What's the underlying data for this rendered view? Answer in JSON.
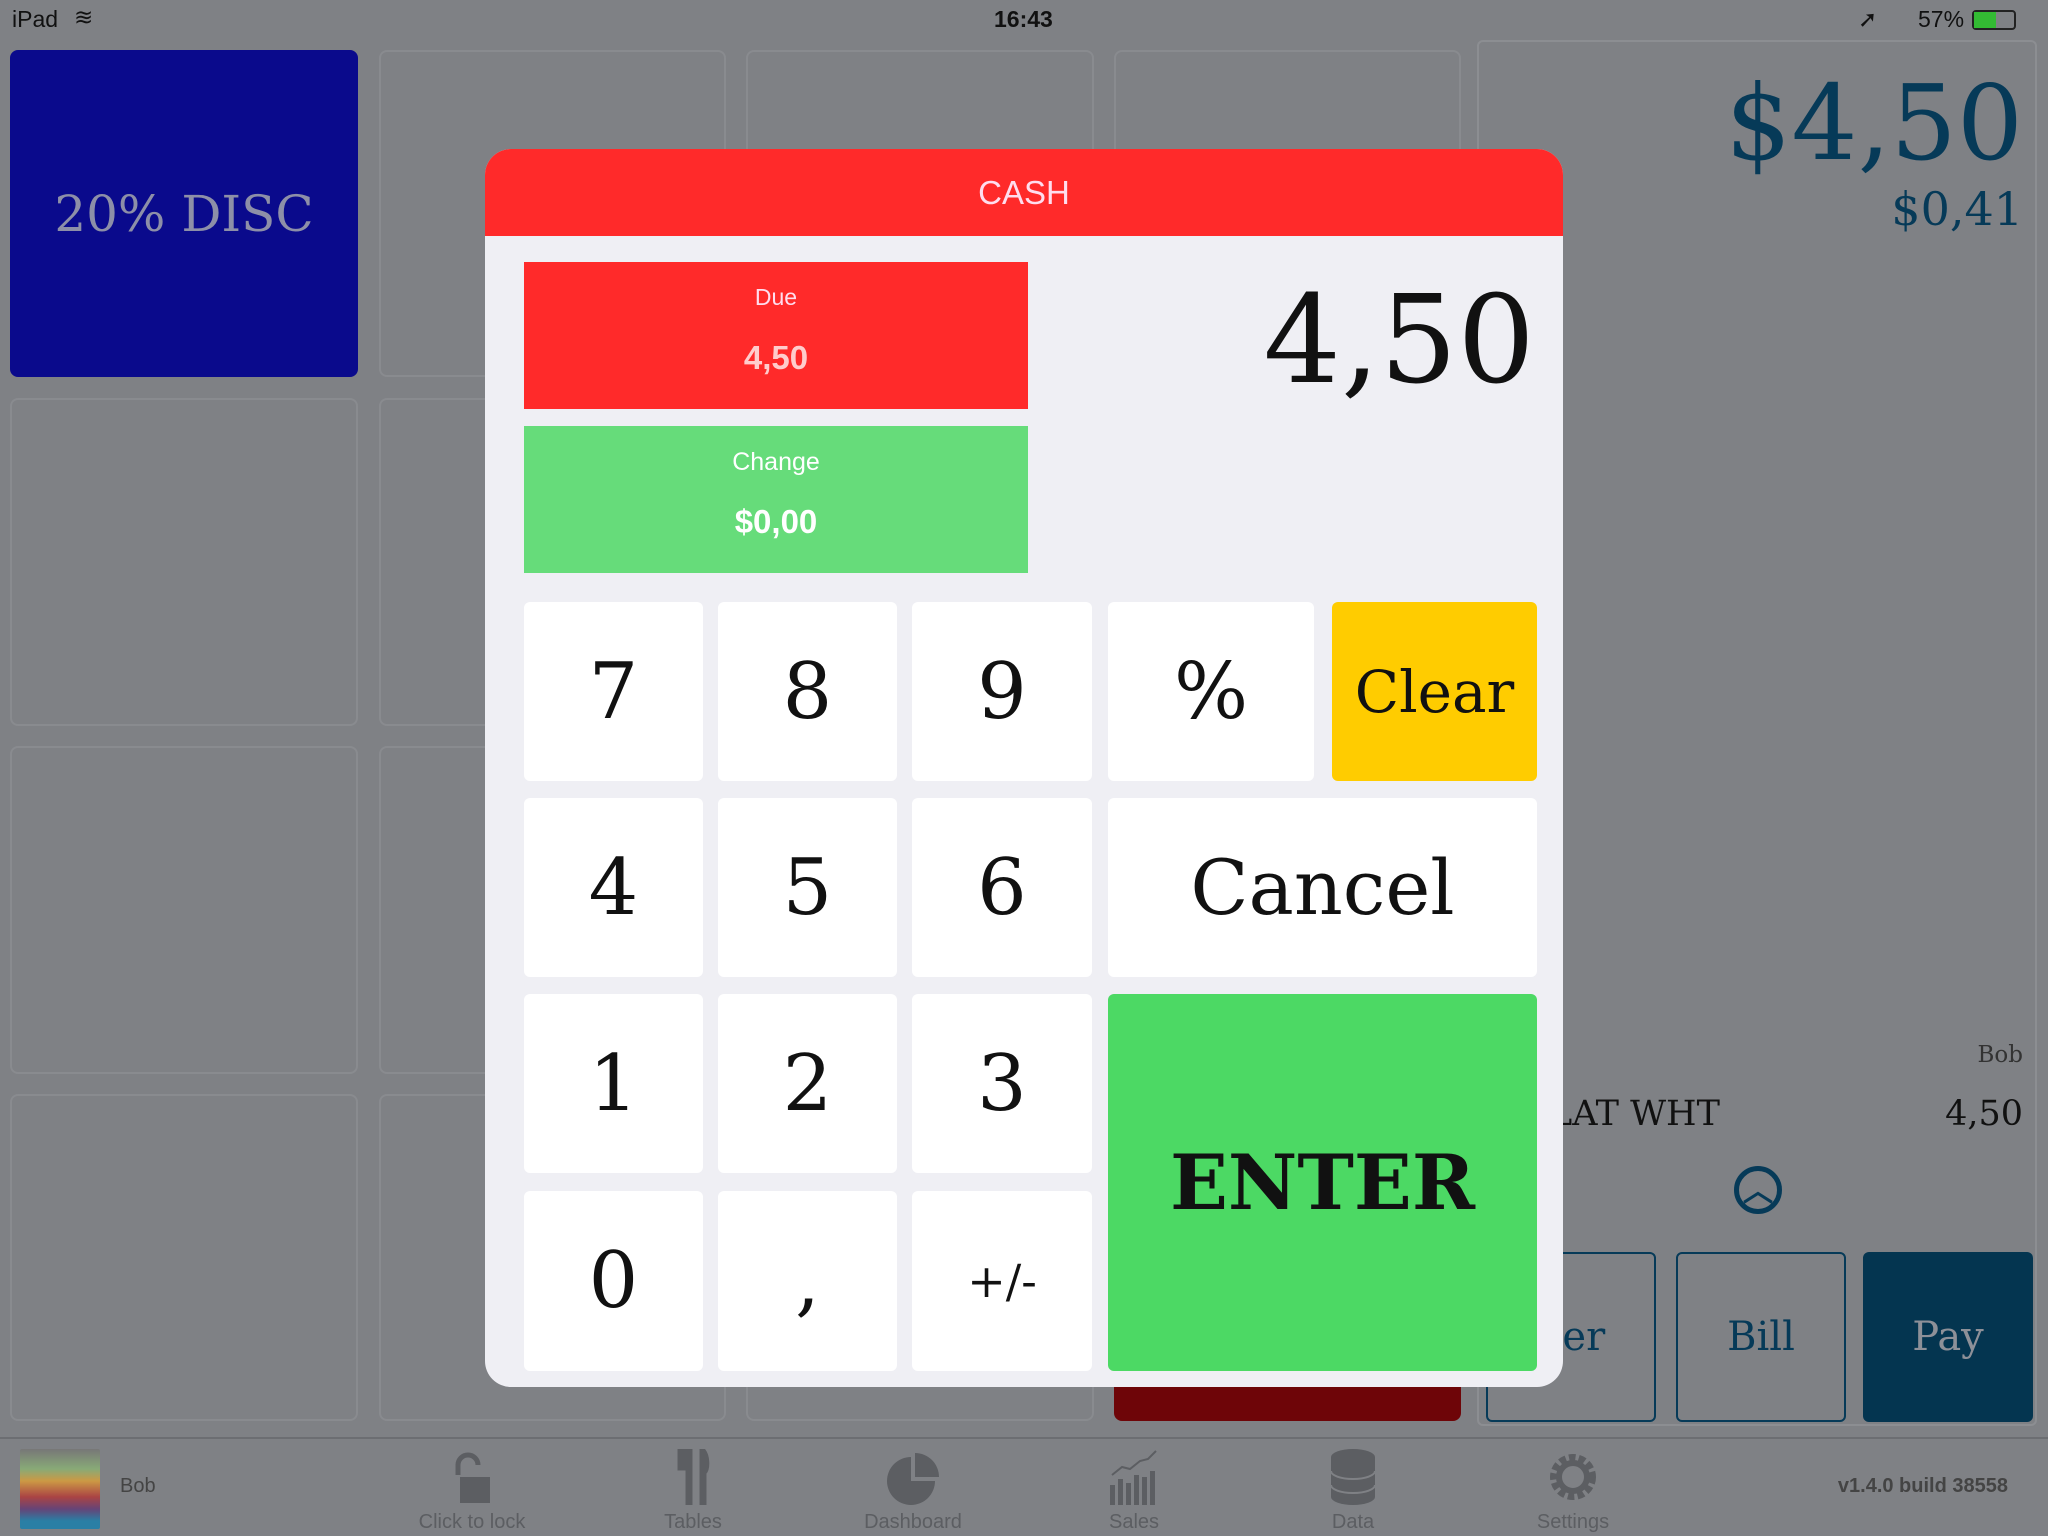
{
  "status_bar": {
    "device": "iPad",
    "time": "16:43",
    "battery": "57%"
  },
  "tiles": {
    "discount": "20% DISC"
  },
  "order_panel": {
    "total": "$4,50",
    "tax": "$0,41",
    "server": "Bob",
    "item_name": "LAT WHT",
    "item_price": "4,50",
    "buttons": {
      "order": "der",
      "bill": "Bill",
      "pay": "Pay"
    }
  },
  "bottom_bar": {
    "user": "Bob",
    "items": [
      {
        "label": "Click to lock",
        "icon": "lock-icon"
      },
      {
        "label": "Tables",
        "icon": "fork-knife-icon"
      },
      {
        "label": "Dashboard",
        "icon": "pie-chart-icon"
      },
      {
        "label": "Sales",
        "icon": "bar-chart-icon"
      },
      {
        "label": "Data",
        "icon": "database-icon"
      },
      {
        "label": "Settings",
        "icon": "gear-icon"
      }
    ],
    "version": "v1.4.0 build 38558"
  },
  "modal": {
    "title": "CASH",
    "due_label": "Due",
    "due_value": "4,50",
    "change_label": "Change",
    "change_value": "$0,00",
    "entry": "4,50",
    "keys": {
      "k7": "7",
      "k8": "8",
      "k9": "9",
      "pct": "%",
      "clear": "Clear",
      "k4": "4",
      "k5": "5",
      "k6": "6",
      "cancel": "Cancel",
      "k1": "1",
      "k2": "2",
      "k3": "3",
      "enter": "ENTER",
      "k0": "0",
      "comma": ",",
      "sign": "+/-"
    }
  },
  "colors": {
    "header": "#ff2a2a",
    "due": "#ff2a2a",
    "change": "#66dc7a",
    "clear": "#ffcc00",
    "enter": "#4cd964",
    "pay": "#043550",
    "discount": "#0a0a8c"
  }
}
